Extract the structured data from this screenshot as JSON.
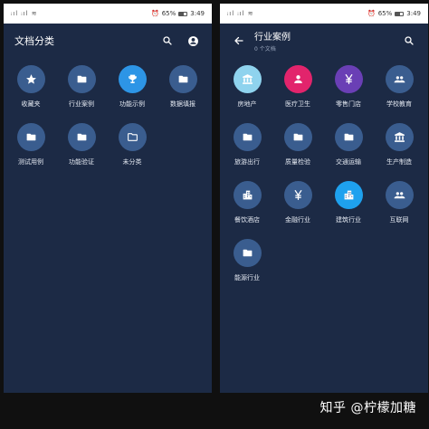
{
  "status_left": {
    "signal": "ᵢıl ᵢıl ≋",
    "battery": "65%",
    "time": "3:49"
  },
  "status_right": {
    "signal": "ᵢıl ᵢıl ≋",
    "battery": "65%",
    "time": "3:49"
  },
  "left_screen": {
    "title": "文档分类",
    "items": [
      {
        "label": "收藏夹",
        "icon": "star-icon",
        "color": "#3a5d8f"
      },
      {
        "label": "行业案例",
        "icon": "folder-icon",
        "color": "#3a5d8f"
      },
      {
        "label": "功能示例",
        "icon": "trophy-icon",
        "color": "#2d95e6"
      },
      {
        "label": "数据填报",
        "icon": "folder-icon",
        "color": "#3a5d8f"
      },
      {
        "label": "测试用例",
        "icon": "folder-icon",
        "color": "#3a5d8f"
      },
      {
        "label": "功能验证",
        "icon": "folder-icon",
        "color": "#3a5d8f"
      },
      {
        "label": "未分类",
        "icon": "folder-outline-icon",
        "color": "#3a5d8f"
      }
    ]
  },
  "right_screen": {
    "title": "行业案例",
    "subtitle": "0 个文档",
    "items": [
      {
        "label": "房地产",
        "icon": "bank-icon",
        "color": "#8fd3ee"
      },
      {
        "label": "医疗卫生",
        "icon": "person-icon",
        "color": "#e2246c"
      },
      {
        "label": "零售门店",
        "icon": "yen-icon",
        "color": "#6a3fb5"
      },
      {
        "label": "学校教育",
        "icon": "people-icon",
        "color": "#3a5d8f"
      },
      {
        "label": "旅游出行",
        "icon": "folder-icon",
        "color": "#3a5d8f"
      },
      {
        "label": "质量检验",
        "icon": "folder-icon",
        "color": "#3a5d8f"
      },
      {
        "label": "交通运输",
        "icon": "folder-icon",
        "color": "#3a5d8f"
      },
      {
        "label": "生产制造",
        "icon": "bank-icon",
        "color": "#3a5d8f"
      },
      {
        "label": "餐饮酒店",
        "icon": "building-icon",
        "color": "#3a5d8f"
      },
      {
        "label": "金融行业",
        "icon": "yen-icon",
        "color": "#3a5d8f"
      },
      {
        "label": "建筑行业",
        "icon": "building-icon",
        "color": "#1ea1ee"
      },
      {
        "label": "互联网",
        "icon": "people-icon",
        "color": "#3a5d8f"
      },
      {
        "label": "能源行业",
        "icon": "folder-icon",
        "color": "#3a5d8f"
      }
    ]
  },
  "watermark": "知乎 @柠檬加糖"
}
